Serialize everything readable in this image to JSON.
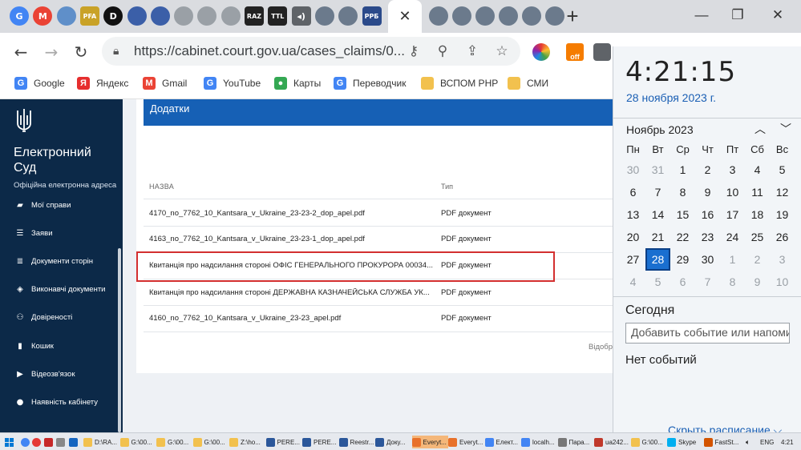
{
  "browser": {
    "tab_favicons": [
      {
        "icon": "google-g-icon",
        "label": "G",
        "color": "#4285f4"
      },
      {
        "icon": "gmail-icon",
        "label": "M",
        "color": "#ea4335"
      },
      {
        "icon": "globe-icon",
        "label": "",
        "color": "#5f8fc9"
      },
      {
        "icon": "pfa-icon",
        "label": "PFA",
        "color": "#c9a227"
      },
      {
        "icon": "d-icon",
        "label": "D",
        "color": "#111111"
      },
      {
        "icon": "emblem-icon",
        "label": "",
        "color": "#3b5fa8"
      },
      {
        "icon": "emblem-icon",
        "label": "",
        "color": "#3b5fa8"
      },
      {
        "icon": "loading-icon",
        "label": "",
        "color": "#9aa0a6"
      },
      {
        "icon": "loading-icon",
        "label": "",
        "color": "#9aa0a6"
      },
      {
        "icon": "loading-icon",
        "label": "",
        "color": "#9aa0a6"
      },
      {
        "icon": "raz-icon",
        "label": "RAZ",
        "color": "#222222"
      },
      {
        "icon": "ttl-icon",
        "label": "TTL",
        "color": "#222222"
      },
      {
        "icon": "speaker-icon",
        "label": "◂)",
        "color": "#5f6368"
      },
      {
        "icon": "globe-icon",
        "label": "",
        "color": "#6b7a8c"
      },
      {
        "icon": "globe-icon",
        "label": "",
        "color": "#6b7a8c"
      },
      {
        "icon": "ppb-icon",
        "label": "PPБ",
        "color": "#2b4a8a"
      }
    ],
    "right_favicons": [
      {
        "icon": "globe-icon",
        "color": "#6b7a8c"
      },
      {
        "icon": "globe-icon",
        "color": "#6b7a8c"
      },
      {
        "icon": "globe-icon",
        "color": "#6b7a8c"
      },
      {
        "icon": "globe-icon",
        "color": "#6b7a8c"
      },
      {
        "icon": "globe-icon",
        "color": "#6b7a8c"
      },
      {
        "icon": "globe-icon",
        "color": "#6b7a8c"
      }
    ],
    "active_tab_close": "✕",
    "new_tab": "+",
    "url": "https://cabinet.court.gov.ua/cases_claims/0...",
    "bookmarks": [
      {
        "icon": "google-icon",
        "label": "Google",
        "color": "#4285f4",
        "glyph": "G"
      },
      {
        "icon": "yandex-icon",
        "label": "Яндекс",
        "color": "#e62e2e",
        "glyph": "Я"
      },
      {
        "icon": "gmail-icon",
        "label": "Gmail",
        "color": "#ea4335",
        "glyph": "M"
      },
      {
        "icon": "google-icon",
        "label": "YouTube",
        "color": "#4285f4",
        "glyph": "G"
      },
      {
        "icon": "maps-pin-icon",
        "label": "Карты",
        "color": "#34a853",
        "glyph": "●"
      },
      {
        "icon": "translate-icon",
        "label": "Переводчик",
        "color": "#4285f4",
        "glyph": "G"
      },
      {
        "icon": "folder-icon",
        "label": "ВСПОМ РНР",
        "color": "#f2c14e",
        "glyph": ""
      },
      {
        "icon": "folder-icon",
        "label": "СМИ",
        "color": "#f2c14e",
        "glyph": ""
      }
    ],
    "ext_off_label": "off"
  },
  "sidebar": {
    "title": "Електронний Суд",
    "subtitle": "Офіційна електронна адреса",
    "items": [
      {
        "icon": "folder-icon",
        "label": "Мої справи",
        "glyph": "▰"
      },
      {
        "icon": "list-icon",
        "label": "Заяви",
        "glyph": "☰"
      },
      {
        "icon": "checklist-icon",
        "label": "Документи сторін",
        "glyph": "≣"
      },
      {
        "icon": "layers-icon",
        "label": "Виконавчі документи",
        "glyph": "◈"
      },
      {
        "icon": "people-icon",
        "label": "Довіреності",
        "glyph": "⚇"
      },
      {
        "icon": "trash-icon",
        "label": "Кошик",
        "glyph": "▮"
      },
      {
        "icon": "video-icon",
        "label": "Відеозв'язок",
        "glyph": "▶"
      },
      {
        "icon": "person-icon",
        "label": "Наявність кабінету",
        "glyph": "●"
      }
    ]
  },
  "main": {
    "section_title": "Додатки",
    "columns": {
      "name": "НАЗВА",
      "type": "Тип"
    },
    "rows": [
      {
        "name": "4170_no_7762_10_Kantsara_v_Ukraine_23-23-2_dop_apel.pdf",
        "type": "PDF документ"
      },
      {
        "name": "4163_no_7762_10_Kantsara_v_Ukraine_23-23-1_dop_apel.pdf",
        "type": "PDF документ"
      },
      {
        "name": "Квитанція про надсилання стороні ОФІС ГЕНЕРАЛЬНОГО ПРОКУРОРА 00034...",
        "type": "PDF документ"
      },
      {
        "name": "Квитанція про надсилання стороні ДЕРЖАВНА КАЗНАЧЕЙСЬКА СЛУЖБА УК...",
        "type": "PDF документ"
      },
      {
        "name": "4160_no_7762_10_Kantsara_v_Ukraine_23-23_apel.pdf",
        "type": "PDF документ"
      }
    ],
    "shown_text": "Відобра",
    "highlight_color": "#d32f2f"
  },
  "calendar": {
    "time": "4:21:15",
    "date_long": "28 ноября 2023 г.",
    "month": "Ноябрь 2023",
    "weekdays": [
      "Пн",
      "Вт",
      "Ср",
      "Чт",
      "Пт",
      "Сб",
      "Вс"
    ],
    "weeks": [
      [
        "30",
        "31",
        "1",
        "2",
        "3",
        "4",
        "5"
      ],
      [
        "6",
        "7",
        "8",
        "9",
        "10",
        "11",
        "12"
      ],
      [
        "13",
        "14",
        "15",
        "16",
        "17",
        "18",
        "19"
      ],
      [
        "20",
        "21",
        "22",
        "23",
        "24",
        "25",
        "26"
      ],
      [
        "27",
        "28",
        "29",
        "30",
        "1",
        "2",
        "3"
      ],
      [
        "4",
        "5",
        "6",
        "7",
        "8",
        "9",
        "10"
      ]
    ],
    "dim_first_week": [
      "30",
      "31"
    ],
    "today": "28",
    "today_label": "Сегодня",
    "event_placeholder": "Добавить событие или напоминание",
    "no_events": "Нет событий",
    "hide_schedule": "Скрыть расписание ⌵",
    "accent": "#1a6fd0"
  },
  "taskbar": {
    "items": [
      {
        "label": "D:\\RA...",
        "color": "#f2c14e",
        "active": false
      },
      {
        "label": "G:\\00...",
        "color": "#f2c14e",
        "active": false
      },
      {
        "label": "G:\\00...",
        "color": "#f2c14e",
        "active": false
      },
      {
        "label": "G:\\00...",
        "color": "#f2c14e",
        "active": false
      },
      {
        "label": "Z:\\ho...",
        "color": "#f2c14e",
        "active": false
      },
      {
        "label": "PERE...",
        "color": "#2b579a",
        "active": false
      },
      {
        "label": "PERE...",
        "color": "#2b579a",
        "active": false
      },
      {
        "label": "Reestr...",
        "color": "#2b579a",
        "active": false
      },
      {
        "label": "Доку...",
        "color": "#2b579a",
        "active": false
      },
      {
        "label": "Everyt...",
        "color": "#e8712a",
        "active": true
      },
      {
        "label": "Everyt...",
        "color": "#e8712a",
        "active": false
      },
      {
        "label": "Елект...",
        "color": "#4285f4",
        "active": false
      },
      {
        "label": "localh...",
        "color": "#4285f4",
        "active": false
      },
      {
        "label": "Пара...",
        "color": "#777777",
        "active": false
      },
      {
        "label": "ua242...",
        "color": "#c0392b",
        "active": false
      },
      {
        "label": "G:\\00...",
        "color": "#f2c14e",
        "active": false
      },
      {
        "label": "Skype",
        "color": "#00aff0",
        "active": false
      },
      {
        "label": "FastSt...",
        "color": "#d35400",
        "active": false
      }
    ],
    "lang": "ENG",
    "time": "4:21"
  }
}
